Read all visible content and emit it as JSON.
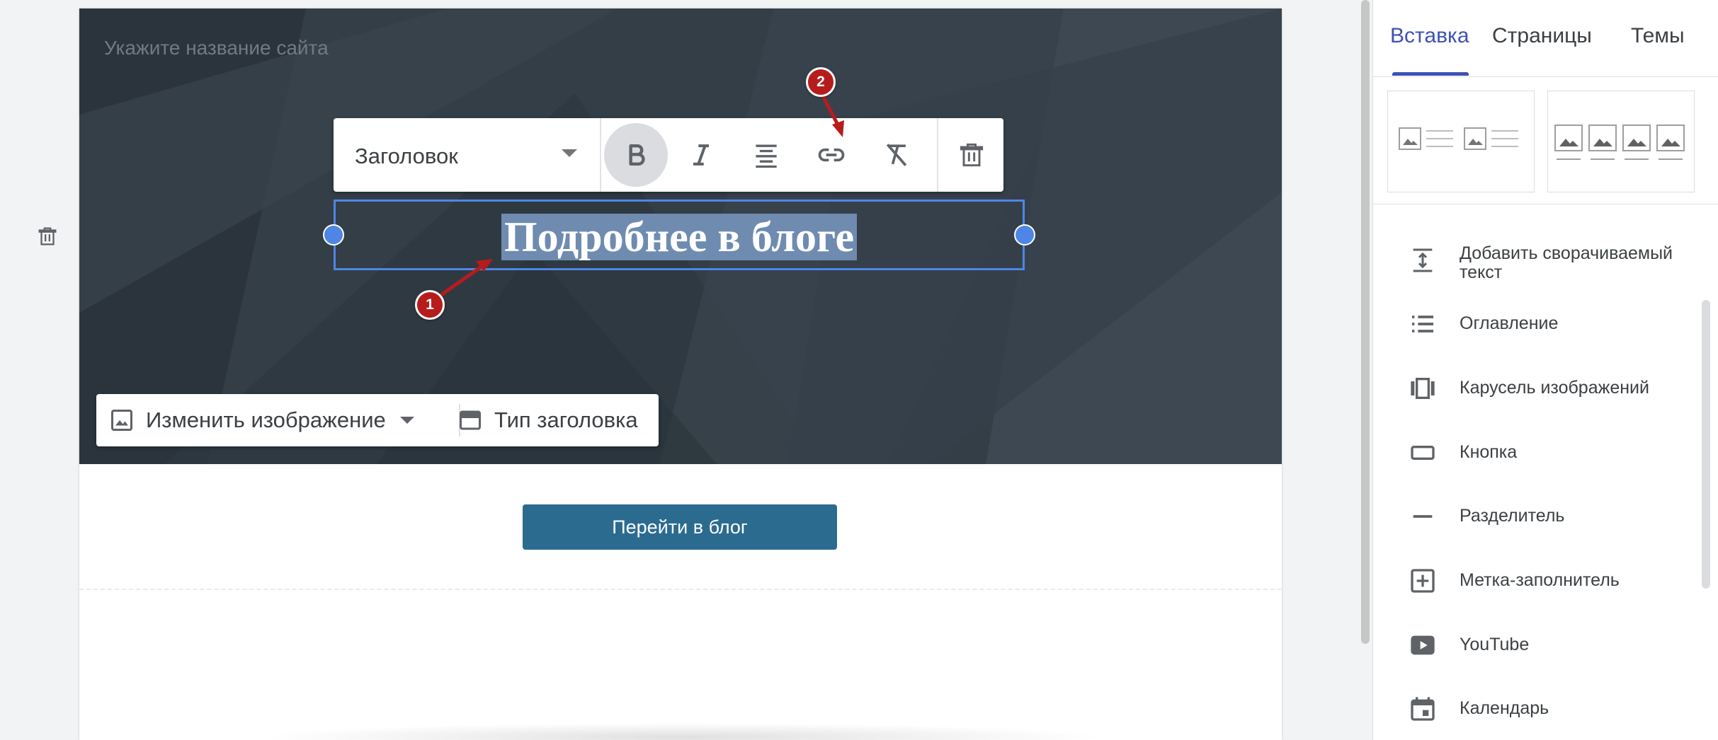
{
  "canvas": {
    "site_name_placeholder": "Укажите название сайта",
    "heading_text": "Подробнее в блоге",
    "blog_button_label": "Перейти в блог"
  },
  "text_toolbar": {
    "style_value": "Заголовок",
    "buttons": [
      "bold",
      "italic",
      "align-center",
      "link",
      "clear-formatting",
      "delete"
    ]
  },
  "image_toolbar": {
    "change_image_label": "Изменить изображение",
    "header_type_label": "Тип заголовка"
  },
  "annotations": {
    "marker_1": "1",
    "marker_2": "2"
  },
  "panel": {
    "tabs": [
      "Вставка",
      "Страницы",
      "Темы"
    ],
    "active_tab": "Вставка",
    "items": [
      {
        "label": "Добавить сворачиваемый текст",
        "icon": "collapsible-text-icon"
      },
      {
        "label": "Оглавление",
        "icon": "table-of-contents-icon"
      },
      {
        "label": "Карусель изображений",
        "icon": "image-carousel-icon"
      },
      {
        "label": "Кнопка",
        "icon": "button-icon"
      },
      {
        "label": "Разделитель",
        "icon": "divider-icon"
      },
      {
        "label": "Метка-заполнитель",
        "icon": "placeholder-icon"
      },
      {
        "label": "YouTube",
        "icon": "youtube-icon"
      },
      {
        "label": "Календарь",
        "icon": "calendar-icon"
      }
    ]
  },
  "colors": {
    "accent": "#3f51b5",
    "selection": "#4f86e6",
    "hero_bg": "#323c45",
    "blog_button": "#2c6b90",
    "annotation": "#b71c1c"
  }
}
